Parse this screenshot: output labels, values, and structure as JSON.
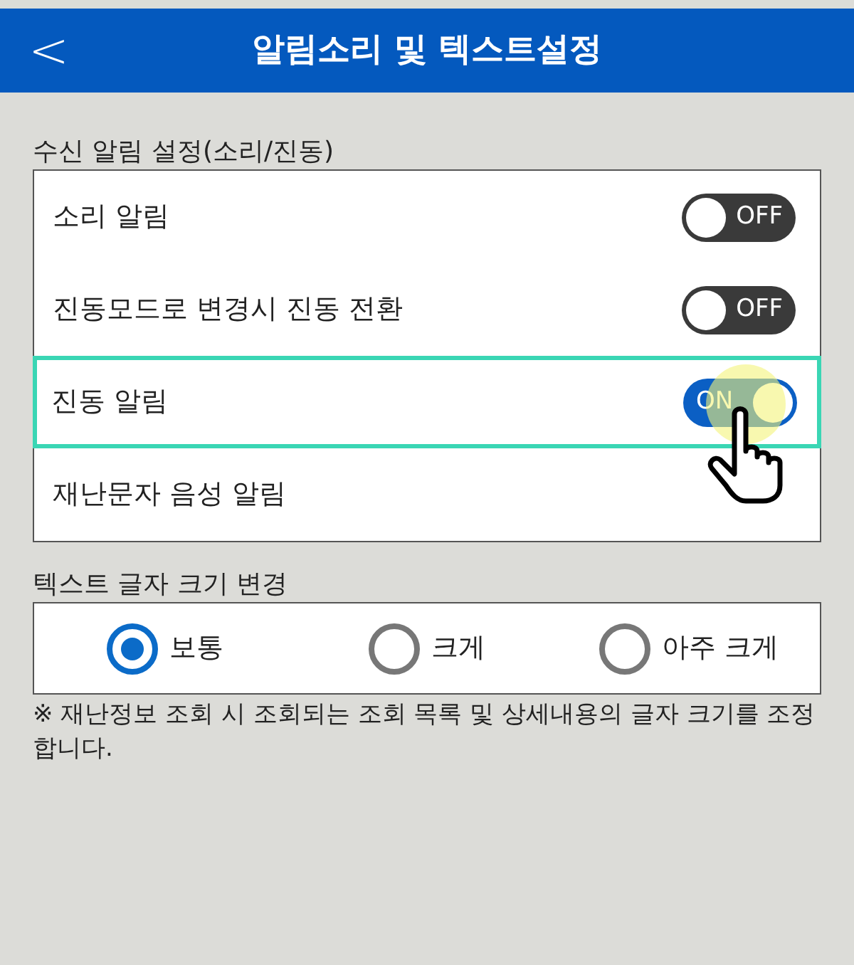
{
  "header": {
    "back_icon_text": "<",
    "title": "알림소리 및 텍스트설정"
  },
  "alert_section": {
    "label": "수신 알림 설정(소리/진동)",
    "rows": [
      {
        "label": "소리 알림",
        "kind": "toggle",
        "on": false,
        "toggle_text": "OFF",
        "highlighted": false
      },
      {
        "label": "진동모드로 변경시 진동 전환",
        "kind": "toggle",
        "on": false,
        "toggle_text": "OFF",
        "highlighted": false
      },
      {
        "label": "진동 알림",
        "kind": "toggle",
        "on": true,
        "toggle_text": "ON",
        "highlighted": true
      },
      {
        "label": "재난문자 음성 알림",
        "kind": "plain",
        "highlighted": false
      }
    ]
  },
  "text_size_section": {
    "label": "텍스트 글자 크기 변경",
    "options": [
      {
        "label": "보통",
        "selected": true
      },
      {
        "label": "크게",
        "selected": false
      },
      {
        "label": "아주 크게",
        "selected": false
      }
    ]
  },
  "note": "※ 재난정보 조회 시 조회되는 조회 목록 및 상세내용의 글자 크기를 조정합니다."
}
